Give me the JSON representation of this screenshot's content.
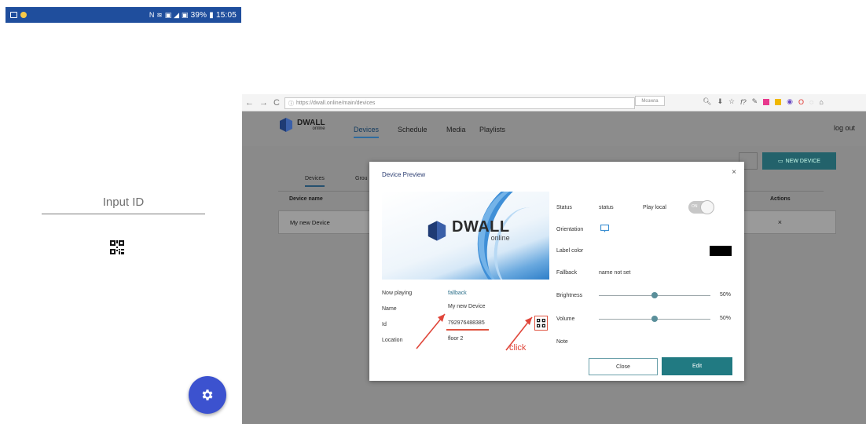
{
  "phone": {
    "status": {
      "right_icons": "N  ≋ ▣ ◢ ▣",
      "battery": "39%",
      "time": "15:05"
    },
    "input_label": "Input ID",
    "fab_icon": "gear-icon"
  },
  "browser": {
    "url": "https://dwall.online/main/devices",
    "url_domain": "dwall.online",
    "search_placeholder": "Мозила",
    "app": {
      "logo_text": "DWALL",
      "logo_sub": "online",
      "nav": [
        "Devices",
        "Schedule",
        "Media",
        "Playlists"
      ],
      "logout": "log out",
      "new_device": "NEW DEVICE",
      "tabs": [
        "Devices",
        "Grou"
      ],
      "table_headers": [
        "Device name",
        "Actions"
      ],
      "row": {
        "name": "My new Device",
        "action": "×"
      }
    },
    "modal": {
      "title": "Device Preview",
      "close_x": "×",
      "preview": {
        "logo_text": "DWALL",
        "logo_sub": "online"
      },
      "left_info": {
        "now_playing_label": "Now playing",
        "now_playing_value": "fallback",
        "name_label": "Name",
        "name_value": "My new Device",
        "id_label": "Id",
        "id_value": "792976488385",
        "location_label": "Location",
        "location_value": "floor 2"
      },
      "right_info": {
        "status_label": "Status",
        "status_value": "status",
        "play_local_label": "Play local",
        "toggle_text": "ON",
        "orientation_label": "Orientation",
        "label_color_label": "Label color",
        "label_color_value": "#000000",
        "fallback_label": "Fallback",
        "fallback_value": "name not set",
        "brightness_label": "Brightness",
        "brightness_value": "50%",
        "brightness_level": 0.5,
        "volume_label": "Volume",
        "volume_value": "50%",
        "volume_level": 0.5,
        "note_label": "Note"
      },
      "close_btn": "Close",
      "edit_btn": "Edit"
    }
  },
  "annotation": {
    "click_label": "click",
    "color": "#e0463a"
  },
  "colors": {
    "status_bar": "#1f4e9d",
    "fab": "#3c52cf",
    "teal": "#217a82"
  }
}
